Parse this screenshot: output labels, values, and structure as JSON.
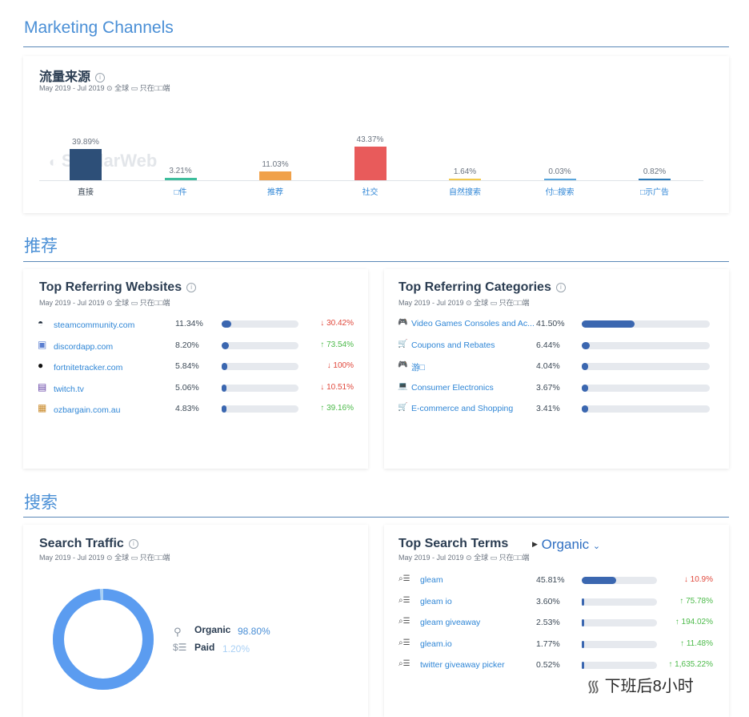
{
  "sections": {
    "marketing": "Marketing Channels",
    "referral": "推荐",
    "search": "搜索"
  },
  "traffic_sources": {
    "title": "流量来源",
    "meta": "May 2019 - Jul 2019 ⊙ 全球 ▭ 只在□□端",
    "watermark": "SimilarWeb",
    "chart_data": {
      "type": "bar",
      "categories": [
        "直接",
        "□件",
        "推荐",
        "社交",
        "自然搜索",
        "付□搜索",
        "□示广告"
      ],
      "values": [
        39.89,
        3.21,
        11.03,
        43.37,
        1.64,
        0.03,
        0.82
      ],
      "value_labels": [
        "39.89%",
        "3.21%",
        "11.03%",
        "43.37%",
        "1.64%",
        "0.03%",
        "0.82%"
      ],
      "colors": [
        "#2d4f78",
        "#3dbd9c",
        "#f0a14a",
        "#e85b5b",
        "#f2c94c",
        "#5aa6dc",
        "#2b7ab8"
      ],
      "label_colors": [
        "#3d4a57",
        "#2f86d6",
        "#2f86d6",
        "#2f86d6",
        "#2f86d6",
        "#2f86d6",
        "#2f86d6"
      ]
    }
  },
  "top_websites": {
    "title": "Top Referring Websites",
    "meta": "May 2019 - Jul 2019 ⊙ 全球 ▭ 只在□□端",
    "rows": [
      {
        "icon": "steam-icon",
        "name": "steamcommunity.com",
        "pct": "11.34%",
        "share": 11.34,
        "change": "↓ 30.42%",
        "dir": "down"
      },
      {
        "icon": "discord-icon",
        "name": "discordapp.com",
        "pct": "8.20%",
        "share": 8.2,
        "change": "↑ 73.54%",
        "dir": "up"
      },
      {
        "icon": "fortnitetracker-icon",
        "name": "fortnitetracker.com",
        "pct": "5.84%",
        "share": 5.84,
        "change": "↓ 100%",
        "dir": "down"
      },
      {
        "icon": "twitch-icon",
        "name": "twitch.tv",
        "pct": "5.06%",
        "share": 5.06,
        "change": "↓ 10.51%",
        "dir": "down"
      },
      {
        "icon": "ozbargain-icon",
        "name": "ozbargain.com.au",
        "pct": "4.83%",
        "share": 4.83,
        "change": "↑ 39.16%",
        "dir": "up"
      }
    ]
  },
  "top_categories": {
    "title": "Top Referring Categories",
    "meta": "May 2019 - Jul 2019 ⊙ 全球 ▭ 只在□□端",
    "rows": [
      {
        "icon": "gamepad-icon",
        "name": "Video Games Consoles and Ac...",
        "pct": "41.50%",
        "share": 41.5
      },
      {
        "icon": "cart-icon",
        "name": "Coupons and Rebates",
        "pct": "6.44%",
        "share": 6.44
      },
      {
        "icon": "gamepad-icon",
        "name": "游□",
        "pct": "4.04%",
        "share": 4.04
      },
      {
        "icon": "laptop-icon",
        "name": "Consumer Electronics",
        "pct": "3.67%",
        "share": 3.67
      },
      {
        "icon": "cart-icon",
        "name": "E-commerce and Shopping",
        "pct": "3.41%",
        "share": 3.41
      }
    ]
  },
  "search_traffic": {
    "title": "Search Traffic",
    "meta": "May 2019 - Jul 2019 ⊙ 全球 ▭ 只在□□端",
    "organic_label": "Organic",
    "organic_value": "98.80%",
    "paid_label": "Paid",
    "paid_value": "1.20%",
    "organic_share": 98.8,
    "colors": {
      "organic": "#5b9cf0",
      "paid": "#a9d0f5"
    }
  },
  "top_search_terms": {
    "title": "Top Search Terms",
    "filter": "Organic",
    "meta": "May 2019 - Jul 2019 ⊙ 全球 ▭ 只在□□端",
    "rows": [
      {
        "term": "gleam",
        "pct": "45.81%",
        "share": 45.81,
        "change": "↓ 10.9%",
        "dir": "down"
      },
      {
        "term": "gleam io",
        "pct": "3.60%",
        "share": 3.6,
        "change": "↑ 75.78%",
        "dir": "up"
      },
      {
        "term": "gleam giveaway",
        "pct": "2.53%",
        "share": 2.53,
        "change": "↑ 194.02%",
        "dir": "up"
      },
      {
        "term": "gleam.io",
        "pct": "1.77%",
        "share": 1.77,
        "change": "↑ 11.48%",
        "dir": "up"
      },
      {
        "term": "twitter giveaway picker",
        "pct": "0.52%",
        "share": 0.52,
        "change": "↑ 1,635.22%",
        "dir": "up"
      }
    ]
  },
  "watermark_footer": "下班后8小时"
}
